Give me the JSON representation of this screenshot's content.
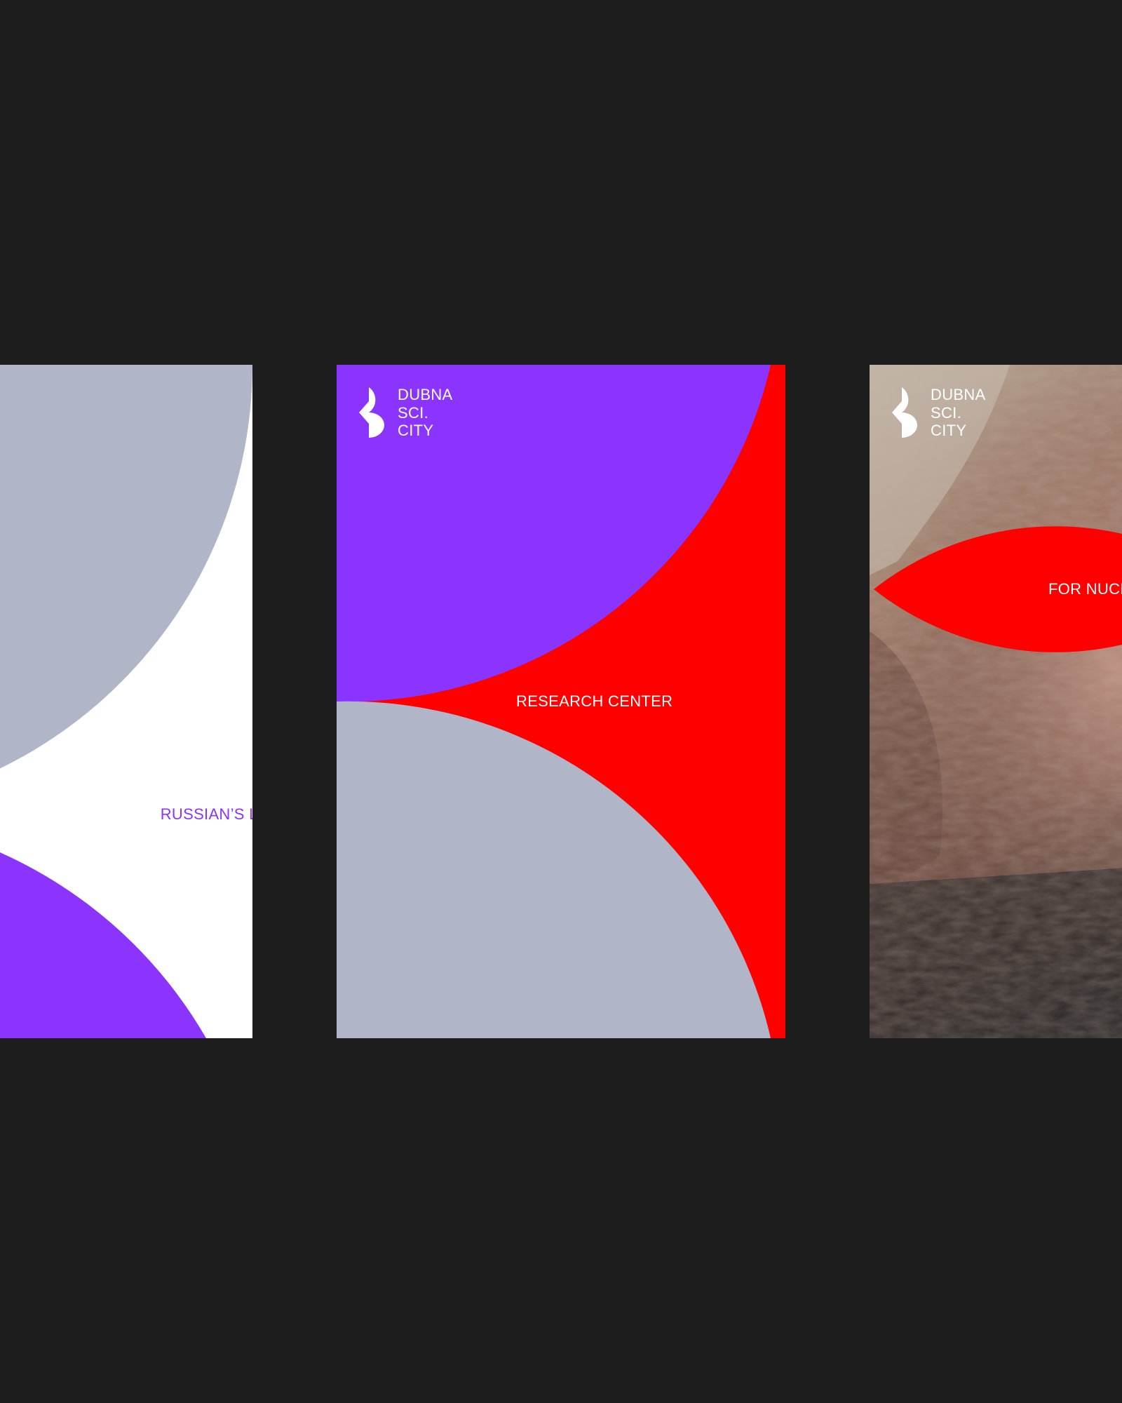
{
  "colors": {
    "background": "#1d1d1d",
    "purple": "#8b33ff",
    "red": "#ff0000",
    "grey": "#b0b5c8",
    "white": "#ffffff"
  },
  "brand": {
    "logo_icon": "dubna-logo-icon",
    "lines": [
      "DUBNA",
      "SCI.",
      "CITY"
    ]
  },
  "posters": [
    {
      "id": "left",
      "headline": "RUSSIAN’S LARGEST",
      "theme": "white-grey-purple"
    },
    {
      "id": "center",
      "headline": "RESEARCH CENTER",
      "theme": "purple-grey-red"
    },
    {
      "id": "right",
      "headline": "FOR NUCLEAR",
      "theme": "painting-red"
    }
  ]
}
